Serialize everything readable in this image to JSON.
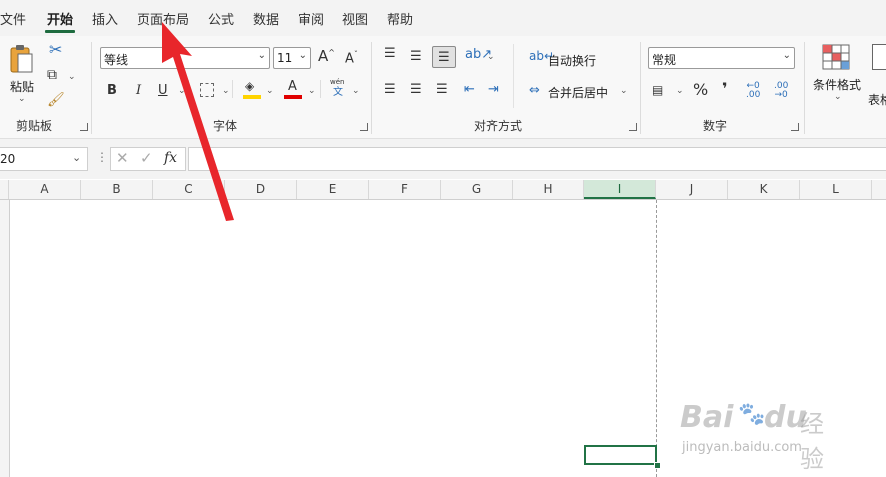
{
  "menu": {
    "file": "文件",
    "home": "开始",
    "insert": "插入",
    "page_layout": "页面布局",
    "formulas": "公式",
    "data": "数据",
    "review": "审阅",
    "view": "视图",
    "help": "帮助"
  },
  "ribbon": {
    "clipboard": {
      "paste_label": "粘贴",
      "group_label": "剪贴板"
    },
    "font": {
      "font_name": "等线",
      "font_size": "11",
      "bold": "B",
      "italic": "I",
      "underline": "U",
      "font_color_letter": "A",
      "phonetic_top": "wén",
      "phonetic_bottom": "文",
      "group_label": "字体"
    },
    "alignment": {
      "wrap_text": "自动换行",
      "merge_center": "合并后居中",
      "group_label": "对齐方式"
    },
    "number": {
      "format": "常规",
      "percent": "%",
      "comma": "❜",
      "group_label": "数字"
    },
    "styles": {
      "conditional_formatting": "条件格式",
      "format_as_table_partial": "表格"
    }
  },
  "formula_bar": {
    "name_box": "20",
    "fx": "fx",
    "formula": ""
  },
  "grid": {
    "columns": [
      "A",
      "B",
      "C",
      "D",
      "E",
      "F",
      "G",
      "H",
      "I",
      "J",
      "K",
      "L"
    ],
    "selected_column": "I"
  },
  "watermark": {
    "brand": "Bai",
    "brand_suffix": "du",
    "product": "经验",
    "url": "jingyan.baidu.com"
  },
  "colors": {
    "accent": "#217346",
    "annotation": "#e8262b",
    "font_color_bar": "#e00000",
    "fill_color_bar": "#ffd400"
  }
}
